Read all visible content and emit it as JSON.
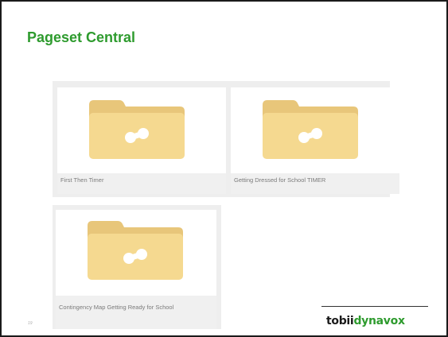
{
  "slide": {
    "title": "Pageset Central",
    "page_number": "19"
  },
  "pagesets": [
    {
      "label": "First Then Timer",
      "icon": "folder-icon"
    },
    {
      "label": "Getting Dressed for School TIMER",
      "icon": "folder-icon"
    },
    {
      "label": "Contingency Map Getting Ready for School",
      "icon": "folder-icon"
    }
  ],
  "brand": {
    "part1": "tobii",
    "part2": "dynavox"
  },
  "colors": {
    "title": "#2e9b2e",
    "folder_body": "#f5d990",
    "folder_tab": "#e8c67a",
    "tile_label_bg": "#f0f0f0"
  }
}
